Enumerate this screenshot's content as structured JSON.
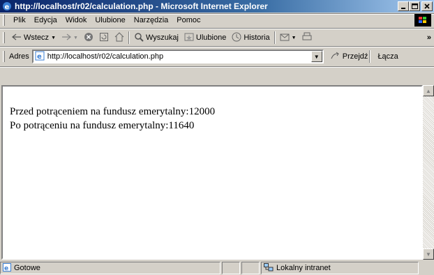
{
  "window": {
    "title": "http://localhost/r02/calculation.php - Microsoft Internet Explorer"
  },
  "menu": {
    "items": [
      "Plik",
      "Edycja",
      "Widok",
      "Ulubione",
      "Narzędzia",
      "Pomoc"
    ]
  },
  "toolbar": {
    "back_label": "Wstecz",
    "search_label": "Wyszukaj",
    "favorites_label": "Ulubione",
    "history_label": "Historia"
  },
  "address": {
    "label": "Adres",
    "url": "http://localhost/r02/calculation.php",
    "go_label": "Przejdź",
    "links_label": "Łącza"
  },
  "page": {
    "line1": "Przed potrąceniem na fundusz emerytalny:12000",
    "line2": "Po potrąceniu na fundusz emerytalny:11640"
  },
  "status": {
    "text": "Gotowe",
    "zone": "Lokalny intranet"
  }
}
